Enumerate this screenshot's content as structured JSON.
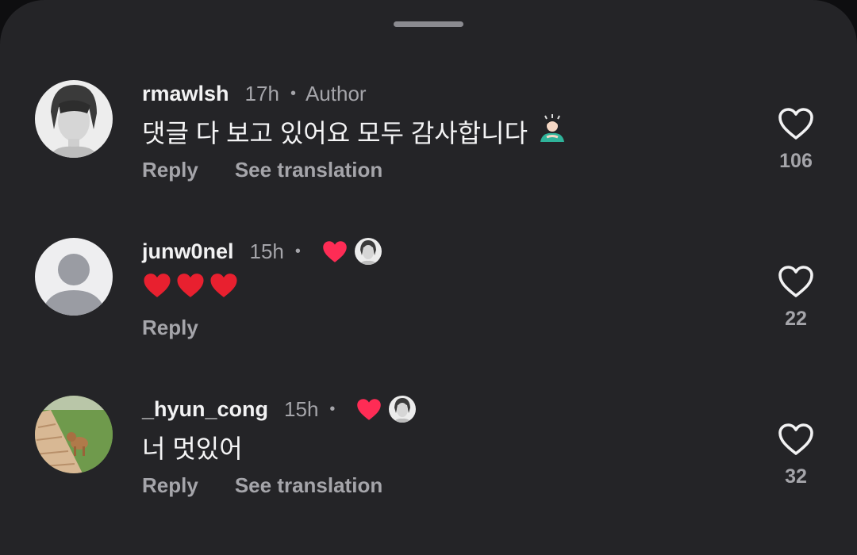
{
  "comments": [
    {
      "username": "rmawlsh",
      "time": "17h",
      "separator": "•",
      "tag": "Author",
      "text": "댓글 다 보고 있어요 모두 감사합니다",
      "text_emoji": "person-bowing-emoji",
      "actions": {
        "reply": "Reply",
        "translate": "See translation"
      },
      "likes": "106",
      "avatar": "monochrome-portrait"
    },
    {
      "username": "junw0nel",
      "time": "15h",
      "separator": "•",
      "reactions": [
        "heart-icon",
        "author-avatar"
      ],
      "text_emoji": [
        "red-heart-emoji",
        "red-heart-emoji",
        "red-heart-emoji"
      ],
      "actions": {
        "reply": "Reply"
      },
      "likes": "22",
      "avatar": "default-profile"
    },
    {
      "username": "_hyun_cong",
      "time": "15h",
      "separator": "•",
      "reactions": [
        "heart-icon",
        "author-avatar"
      ],
      "text": "너 멋있어",
      "actions": {
        "reply": "Reply",
        "translate": "See translation"
      },
      "likes": "32",
      "avatar": "dog-on-path-photo"
    }
  ],
  "colors": {
    "sheet": "#242427",
    "username": "#f2f2f3",
    "secondary": "#a5a5aa",
    "heart": "#fe2c55",
    "emoji_heart": "#e8202f"
  }
}
